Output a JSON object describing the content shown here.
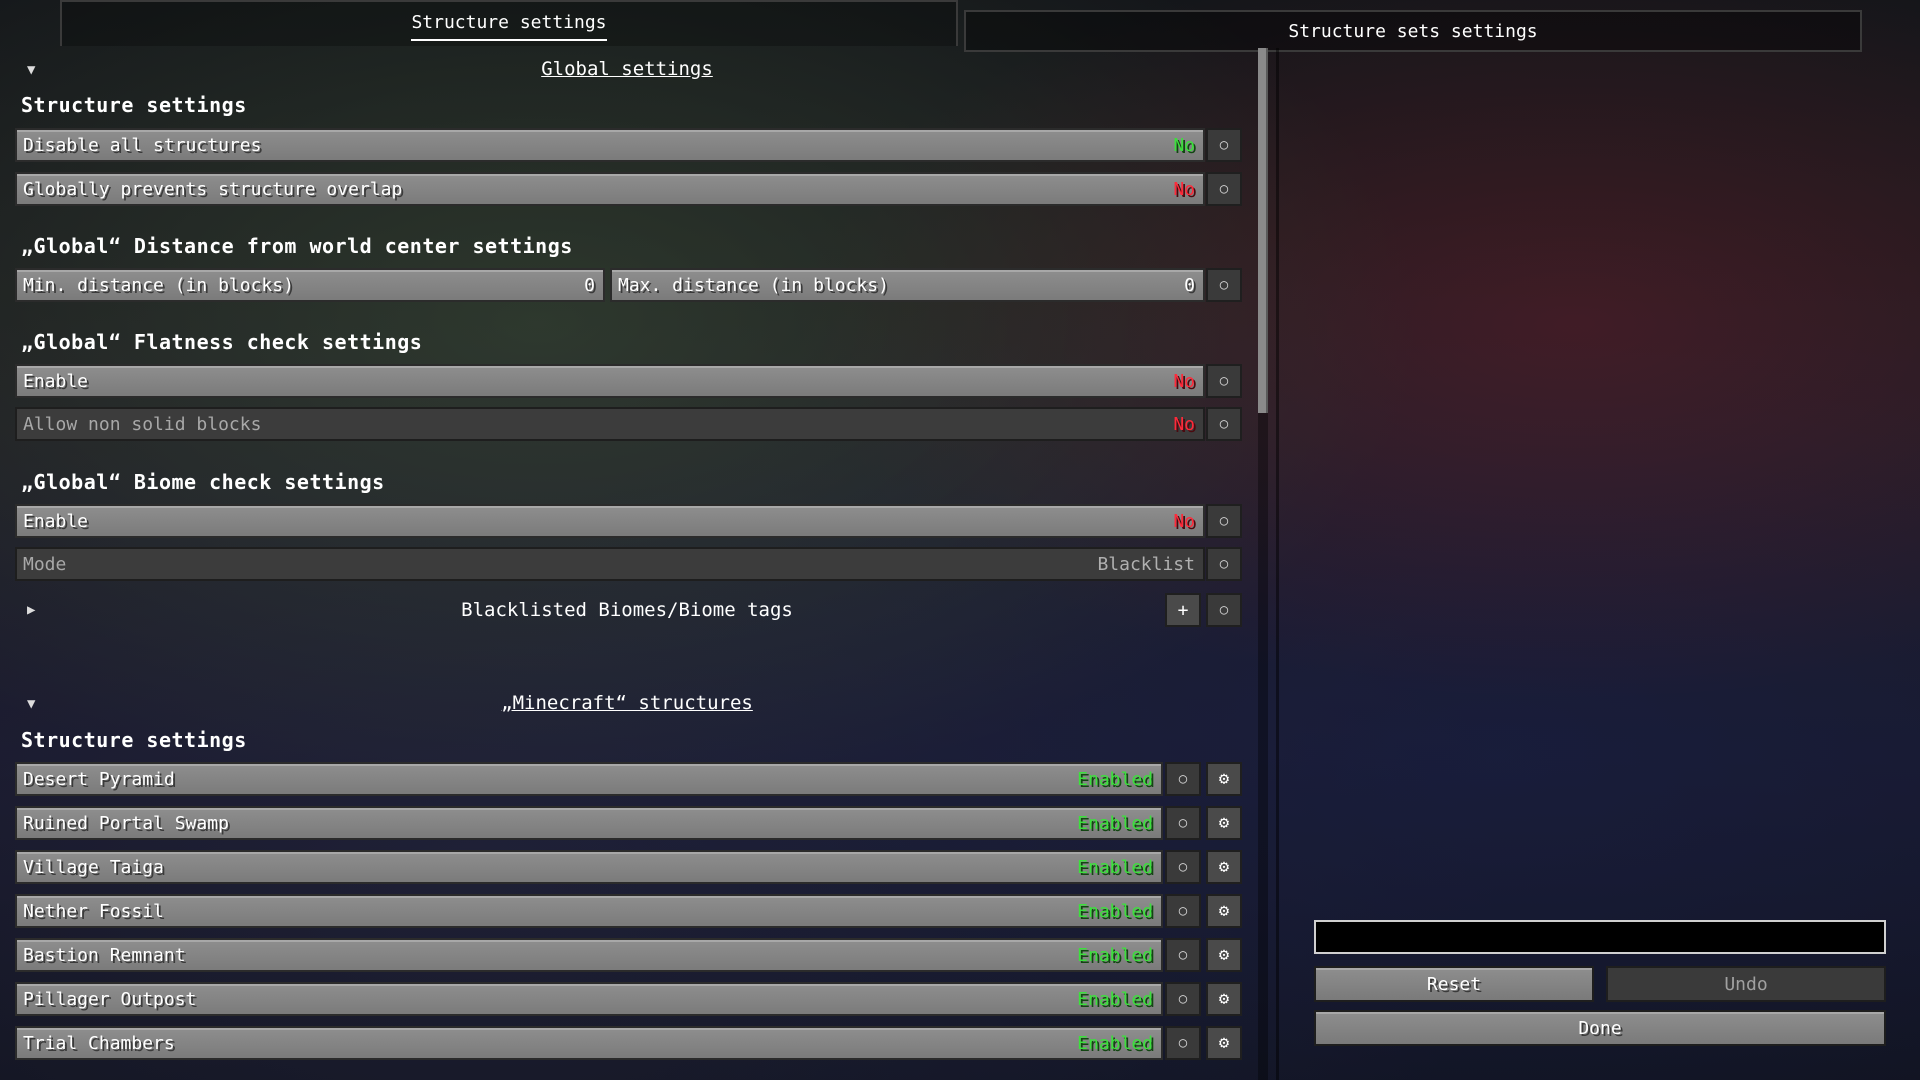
{
  "tabs": {
    "structure_settings": "Structure settings",
    "structure_sets_settings": "Structure sets settings"
  },
  "global": {
    "header": "Global settings",
    "structure_settings_title": "Structure settings",
    "disable_all_label": "Disable all structures",
    "disable_all_value": "No",
    "prevent_overlap_label": "Globally prevents structure overlap",
    "prevent_overlap_value": "No",
    "distance_title": "„Global“ Distance from world center settings",
    "min_distance_label": "Min. distance (in blocks)",
    "min_distance_value": "0",
    "max_distance_label": "Max. distance (in blocks)",
    "max_distance_value": "0",
    "flatness_title": "„Global“ Flatness check settings",
    "flatness_enable_label": "Enable",
    "flatness_enable_value": "No",
    "allow_non_solid_label": "Allow non solid blocks",
    "allow_non_solid_value": "No",
    "biome_title": "„Global“ Biome check settings",
    "biome_enable_label": "Enable",
    "biome_enable_value": "No",
    "mode_label": "Mode",
    "mode_value": "Blacklist",
    "blacklisted_label": "Blacklisted Biomes/Biome tags",
    "add_symbol": "+"
  },
  "minecraft": {
    "header": "„Minecraft“ structures",
    "structure_settings_title": "Structure settings",
    "structures": [
      {
        "name": "Desert Pyramid",
        "status": "Enabled"
      },
      {
        "name": "Ruined Portal Swamp",
        "status": "Enabled"
      },
      {
        "name": "Village Taiga",
        "status": "Enabled"
      },
      {
        "name": "Nether Fossil",
        "status": "Enabled"
      },
      {
        "name": "Bastion Remnant",
        "status": "Enabled"
      },
      {
        "name": "Pillager Outpost",
        "status": "Enabled"
      },
      {
        "name": "Trial Chambers",
        "status": "Enabled"
      }
    ]
  },
  "icons": {
    "reset_small": "○",
    "gear": "⚙",
    "caret_down": "▼",
    "caret_right": "▶"
  },
  "actions": {
    "reset": "Reset",
    "undo": "Undo",
    "done": "Done"
  },
  "colors": {
    "enabled_green": "#3ce03c",
    "no_red": "#ff2a3a",
    "no_green": "#3ce03c"
  }
}
